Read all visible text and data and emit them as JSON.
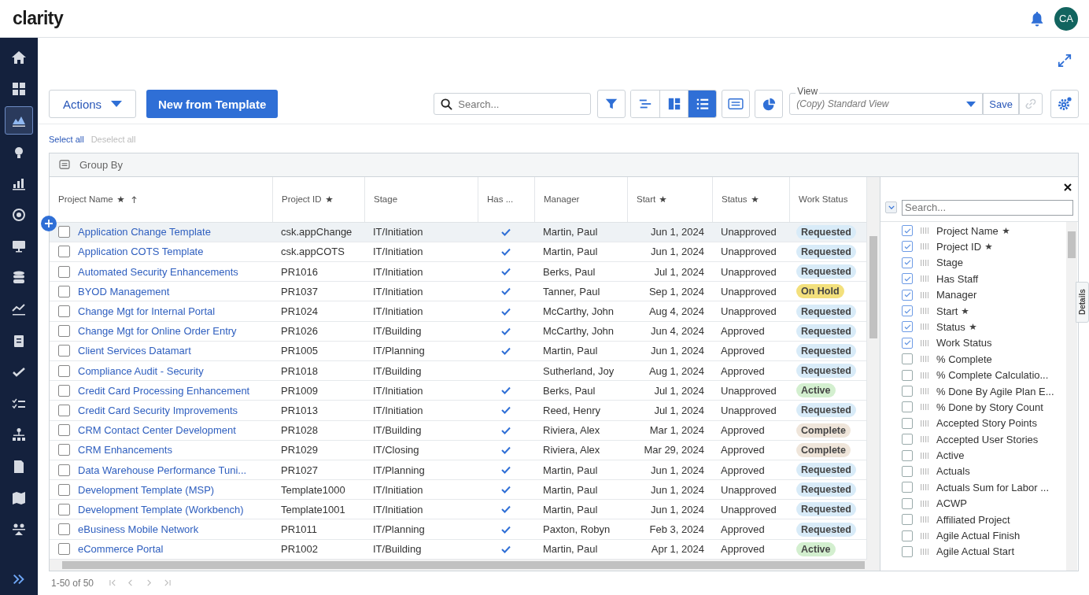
{
  "app": {
    "logo": "clarity",
    "avatar": "CA"
  },
  "nav": [
    {
      "selected": false
    },
    {
      "selected": false
    },
    {
      "selected": true
    },
    {
      "selected": false
    },
    {
      "selected": false
    },
    {
      "selected": false
    },
    {
      "selected": false
    },
    {
      "selected": false
    },
    {
      "selected": false
    },
    {
      "selected": false
    },
    {
      "selected": false
    },
    {
      "selected": false
    },
    {
      "selected": false
    },
    {
      "selected": false
    },
    {
      "selected": false
    },
    {
      "selected": false
    }
  ],
  "toolbar": {
    "actions": "Actions",
    "new_button": "New from Template",
    "search": {
      "placeholder": "Search..."
    },
    "view_modes": [
      {
        "selected": false
      },
      {
        "selected": false
      },
      {
        "selected": true
      }
    ],
    "view": {
      "label": "View",
      "value": "(Copy) Standard View"
    },
    "save": "Save",
    "link_disabled": true
  },
  "selection": {
    "select_all": "Select all",
    "deselect_all": "Deselect all",
    "deselect_disabled": true
  },
  "group_by": "Group By",
  "table": {
    "columns": [
      {
        "label": "Project Name",
        "required": true,
        "sorted": true
      },
      {
        "label": "Project ID",
        "required": true,
        "sorted": false
      },
      {
        "label": "Stage",
        "required": false,
        "sorted": false
      },
      {
        "label": "Has ...",
        "required": false,
        "sorted": false
      },
      {
        "label": "Manager",
        "required": false,
        "sorted": false
      },
      {
        "label": "Start",
        "required": true,
        "sorted": false
      },
      {
        "label": "Status",
        "required": true,
        "sorted": false
      },
      {
        "label": "Work Status",
        "required": false,
        "sorted": false
      }
    ],
    "rows": [
      {
        "name": "Application Change Template",
        "id": "csk.appChange",
        "stage": "IT/Initiation",
        "has_staff": true,
        "manager": "Martin, Paul",
        "start": "Jun 1, 2024",
        "status": "Unapproved",
        "work_status": "Requested",
        "color": "#d8ebf8",
        "selected": false,
        "hovered": true
      },
      {
        "name": "Application COTS Template",
        "id": "csk.appCOTS",
        "stage": "IT/Initiation",
        "has_staff": true,
        "manager": "Martin, Paul",
        "start": "Jun 1, 2024",
        "status": "Unapproved",
        "work_status": "Requested",
        "color": "#d8ebf8",
        "selected": false,
        "hovered": false
      },
      {
        "name": "Automated Security Enhancements",
        "id": "PR1016",
        "stage": "IT/Initiation",
        "has_staff": true,
        "manager": "Berks, Paul",
        "start": "Jul 1, 2024",
        "status": "Unapproved",
        "work_status": "Requested",
        "color": "#d8ebf8",
        "selected": false,
        "hovered": false
      },
      {
        "name": "BYOD Management",
        "id": "PR1037",
        "stage": "IT/Initiation",
        "has_staff": true,
        "manager": "Tanner, Paul",
        "start": "Sep 1, 2024",
        "status": "Unapproved",
        "work_status": "On Hold",
        "color": "#f3e07c",
        "selected": false,
        "hovered": false
      },
      {
        "name": "Change Mgt for Internal Portal",
        "id": "PR1024",
        "stage": "IT/Initiation",
        "has_staff": true,
        "manager": "McCarthy, John",
        "start": "Aug 4, 2024",
        "status": "Unapproved",
        "work_status": "Requested",
        "color": "#d8ebf8",
        "selected": false,
        "hovered": false
      },
      {
        "name": "Change Mgt for Online Order Entry",
        "id": "PR1026",
        "stage": "IT/Building",
        "has_staff": true,
        "manager": "McCarthy, John",
        "start": "Jun 4, 2024",
        "status": "Approved",
        "work_status": "Requested",
        "color": "#d8ebf8",
        "selected": false,
        "hovered": false
      },
      {
        "name": "Client Services Datamart",
        "id": "PR1005",
        "stage": "IT/Planning",
        "has_staff": true,
        "manager": "Martin, Paul",
        "start": "Jun 1, 2024",
        "status": "Approved",
        "work_status": "Requested",
        "color": "#d8ebf8",
        "selected": false,
        "hovered": false
      },
      {
        "name": "Compliance Audit - Security",
        "id": "PR1018",
        "stage": "IT/Building",
        "has_staff": false,
        "manager": "Sutherland, Joy",
        "start": "Aug 1, 2024",
        "status": "Approved",
        "work_status": "Requested",
        "color": "#d8ebf8",
        "selected": false,
        "hovered": false
      },
      {
        "name": "Credit Card Processing Enhancement",
        "id": "PR1009",
        "stage": "IT/Initiation",
        "has_staff": true,
        "manager": "Berks, Paul",
        "start": "Jul 1, 2024",
        "status": "Unapproved",
        "work_status": "Active",
        "color": "#d3efcf",
        "selected": false,
        "hovered": false
      },
      {
        "name": "Credit Card Security Improvements",
        "id": "PR1013",
        "stage": "IT/Initiation",
        "has_staff": true,
        "manager": "Reed, Henry",
        "start": "Jul 1, 2024",
        "status": "Unapproved",
        "work_status": "Requested",
        "color": "#d8ebf8",
        "selected": false,
        "hovered": false
      },
      {
        "name": "CRM Contact Center Development",
        "id": "PR1028",
        "stage": "IT/Building",
        "has_staff": true,
        "manager": "Riviera, Alex",
        "start": "Mar 1, 2024",
        "status": "Approved",
        "work_status": "Complete",
        "color": "#efe5da",
        "selected": false,
        "hovered": false
      },
      {
        "name": "CRM Enhancements",
        "id": "PR1029",
        "stage": "IT/Closing",
        "has_staff": true,
        "manager": "Riviera, Alex",
        "start": "Mar 29, 2024",
        "status": "Approved",
        "work_status": "Complete",
        "color": "#efe5da",
        "selected": false,
        "hovered": false
      },
      {
        "name": "Data Warehouse Performance Tuni...",
        "id": "PR1027",
        "stage": "IT/Planning",
        "has_staff": true,
        "manager": "Martin, Paul",
        "start": "Jun 1, 2024",
        "status": "Approved",
        "work_status": "Requested",
        "color": "#d8ebf8",
        "selected": false,
        "hovered": false
      },
      {
        "name": "Development Template (MSP)",
        "id": "Template1000",
        "stage": "IT/Initiation",
        "has_staff": true,
        "manager": "Martin, Paul",
        "start": "Jun 1, 2024",
        "status": "Unapproved",
        "work_status": "Requested",
        "color": "#d8ebf8",
        "selected": false,
        "hovered": false
      },
      {
        "name": "Development Template (Workbench)",
        "id": "Template1001",
        "stage": "IT/Initiation",
        "has_staff": true,
        "manager": "Martin, Paul",
        "start": "Jun 1, 2024",
        "status": "Unapproved",
        "work_status": "Requested",
        "color": "#d8ebf8",
        "selected": false,
        "hovered": false
      },
      {
        "name": "eBusiness Mobile Network",
        "id": "PR1011",
        "stage": "IT/Planning",
        "has_staff": true,
        "manager": "Paxton, Robyn",
        "start": "Feb 3, 2024",
        "status": "Approved",
        "work_status": "Requested",
        "color": "#d8ebf8",
        "selected": false,
        "hovered": false
      },
      {
        "name": "eCommerce Portal",
        "id": "PR1002",
        "stage": "IT/Building",
        "has_staff": true,
        "manager": "Martin, Paul",
        "start": "Apr 1, 2024",
        "status": "Approved",
        "work_status": "Active",
        "color": "#d3efcf",
        "selected": false,
        "hovered": false
      }
    ]
  },
  "column_panel": {
    "search": {
      "placeholder": "Search..."
    },
    "items": [
      {
        "label": "Project Name",
        "checked": true,
        "required": true
      },
      {
        "label": "Project ID",
        "checked": true,
        "required": true
      },
      {
        "label": "Stage",
        "checked": true,
        "required": false
      },
      {
        "label": "Has Staff",
        "checked": true,
        "required": false
      },
      {
        "label": "Manager",
        "checked": true,
        "required": false
      },
      {
        "label": "Start",
        "checked": true,
        "required": true
      },
      {
        "label": "Status",
        "checked": true,
        "required": true
      },
      {
        "label": "Work Status",
        "checked": true,
        "required": false
      },
      {
        "label": "% Complete",
        "checked": false,
        "required": false
      },
      {
        "label": "% Complete Calculatio...",
        "checked": false,
        "required": false
      },
      {
        "label": "% Done By Agile Plan E...",
        "checked": false,
        "required": false
      },
      {
        "label": "% Done by Story Count",
        "checked": false,
        "required": false
      },
      {
        "label": "Accepted Story Points",
        "checked": false,
        "required": false
      },
      {
        "label": "Accepted User Stories",
        "checked": false,
        "required": false
      },
      {
        "label": "Active",
        "checked": false,
        "required": false
      },
      {
        "label": "Actuals",
        "checked": false,
        "required": false
      },
      {
        "label": "Actuals Sum for Labor ...",
        "checked": false,
        "required": false
      },
      {
        "label": "ACWP",
        "checked": false,
        "required": false
      },
      {
        "label": "Affiliated Project",
        "checked": false,
        "required": false
      },
      {
        "label": "Agile Actual Finish",
        "checked": false,
        "required": false
      },
      {
        "label": "Agile Actual Start",
        "checked": false,
        "required": false
      }
    ]
  },
  "details_tab": "Details",
  "pager": {
    "range": "1-50 of 50",
    "nav_disabled": true
  }
}
